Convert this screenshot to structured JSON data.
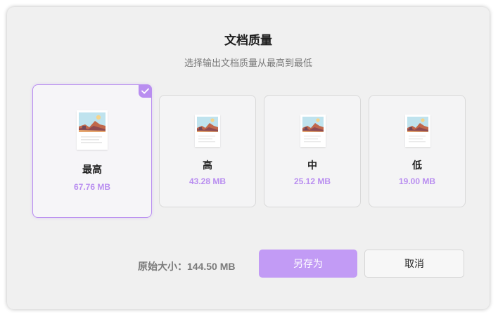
{
  "dialog": {
    "title": "文档质量",
    "subtitle": "选择输出文档质量从最高到最低"
  },
  "options": [
    {
      "label": "最高",
      "size": "67.76 MB",
      "selected": true
    },
    {
      "label": "高",
      "size": "43.28 MB",
      "selected": false
    },
    {
      "label": "中",
      "size": "25.12 MB",
      "selected": false
    },
    {
      "label": "低",
      "size": "19.00 MB",
      "selected": false
    }
  ],
  "original_size": "原始大小：144.50 MB",
  "buttons": {
    "save_as": "另存为",
    "cancel": "取消"
  },
  "colors": {
    "accent": "#b98ef0",
    "save_button": "#c29bf5",
    "dialog_bg": "#f0f0f0"
  },
  "icons": {
    "selected_marker": "check-icon",
    "preview": "document-landscape-thumbnail"
  }
}
